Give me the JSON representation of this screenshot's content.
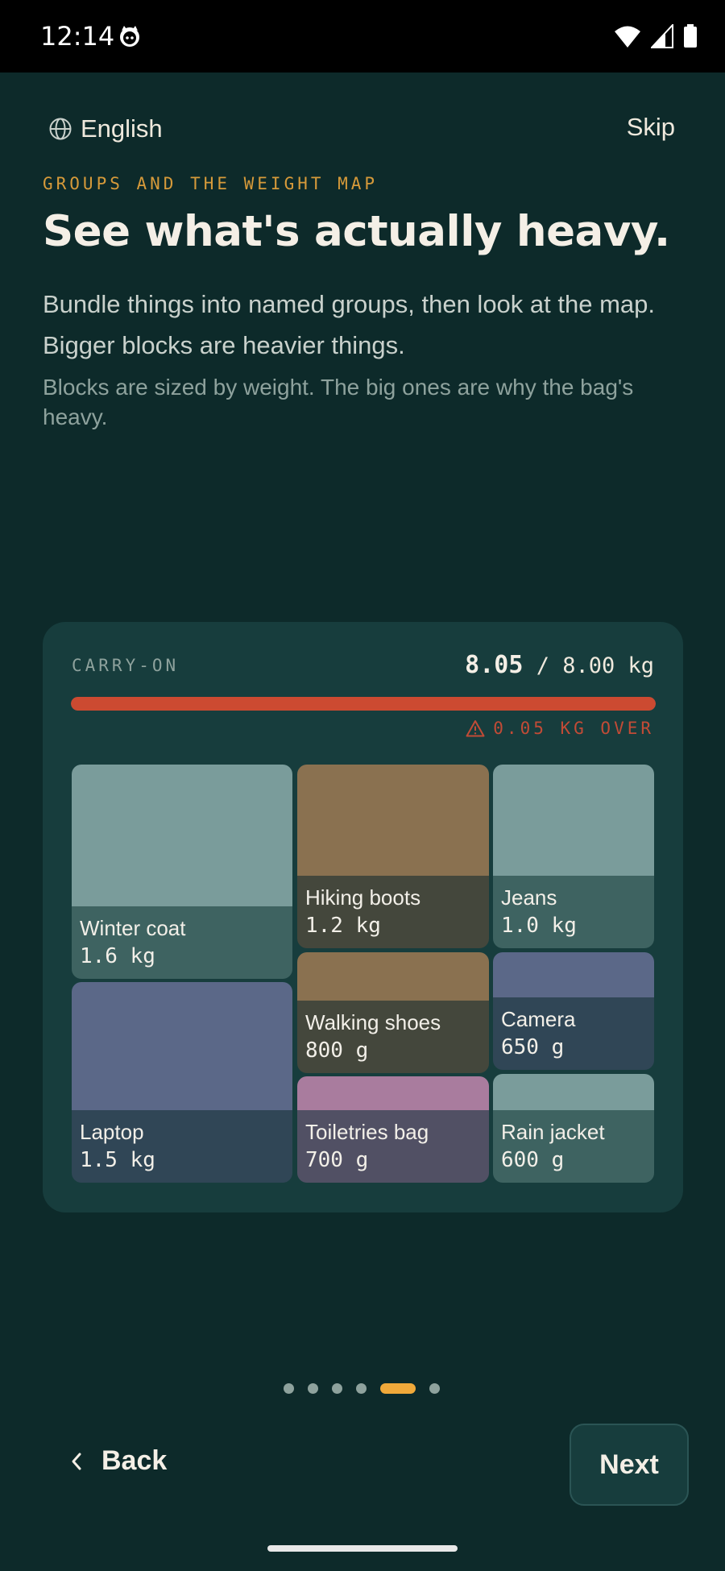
{
  "status": {
    "time": "12:14"
  },
  "topbar": {
    "language": "English",
    "skip": "Skip"
  },
  "content": {
    "eyebrow": "GROUPS AND THE WEIGHT MAP",
    "title": "See what's actually heavy.",
    "body": "Bundle things into named groups, then look at the map. Bigger blocks are heavier things.",
    "sub": "Blocks are sized by weight. The big ones are why the bag's heavy."
  },
  "card": {
    "label": "CARRY-ON",
    "current": "8.05",
    "limit": "/ 8.00 kg",
    "fill_fraction": 1.0,
    "over": "0.05 KG OVER",
    "blocks": [
      {
        "name": "Winter coat",
        "weight": "1.6 kg",
        "top": "#7a9c9b",
        "bottom": "#3e6361"
      },
      {
        "name": "Laptop",
        "weight": "1.5 kg",
        "top": "#5b6888",
        "bottom": "#304656"
      },
      {
        "name": "Hiking boots",
        "weight": "1.2 kg",
        "top": "#8a7150",
        "bottom": "#44473c"
      },
      {
        "name": "Walking shoes",
        "weight": "800 g",
        "top": "#8a7150",
        "bottom": "#44473c"
      },
      {
        "name": "Toiletries bag",
        "weight": "700 g",
        "top": "#a97c9e",
        "bottom": "#515064"
      },
      {
        "name": "Jeans",
        "weight": "1.0 kg",
        "top": "#7a9c9b",
        "bottom": "#3e6361"
      },
      {
        "name": "Camera",
        "weight": "650 g",
        "top": "#5b6888",
        "bottom": "#304656"
      },
      {
        "name": "Rain jacket",
        "weight": "600 g",
        "top": "#7a9c9b",
        "bottom": "#3e6361"
      }
    ]
  },
  "pager": {
    "total": 6,
    "active_index": 4
  },
  "nav": {
    "back": "Back",
    "next": "Next"
  }
}
